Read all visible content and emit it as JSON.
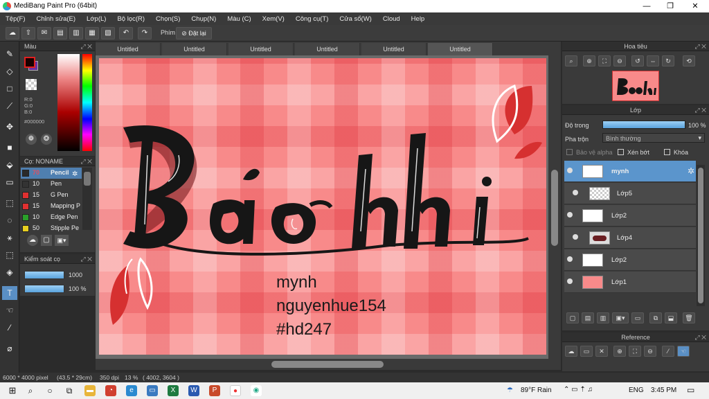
{
  "window": {
    "title": "MediBang Paint Pro (64bit)",
    "min": "—",
    "restore": "❐",
    "close": "✕"
  },
  "menu": [
    "Tệp(F)",
    "Chỉnh sửa(E)",
    "Lớp(L)",
    "Bộ lọc(R)",
    "Chọn(S)",
    "Chụp(N)",
    "Màu (C)",
    "Xem(V)",
    "Công cụ(T)",
    "Cửa sổ(W)",
    "Cloud",
    "Help"
  ],
  "toolbar": {
    "phim_label": "Phím",
    "reset_label": "Đặt lại"
  },
  "color_panel": {
    "title": "Màu",
    "foreground": "#1a0000",
    "background": "#6a2fa0",
    "r": "R:0",
    "g": "G:0",
    "b": "B:0",
    "hex": "#000000"
  },
  "brush_panel": {
    "title": "Cọ: NONAME",
    "brushes": [
      {
        "size": "70",
        "name": "Pencil",
        "color": "#2a2a2a"
      },
      {
        "size": "10",
        "name": "Pen",
        "color": "#333333"
      },
      {
        "size": "15",
        "name": "G Pen",
        "color": "#e03030"
      },
      {
        "size": "15",
        "name": "Mapping P",
        "color": "#e03030"
      },
      {
        "size": "10",
        "name": "Edge Pen",
        "color": "#2aa02a"
      },
      {
        "size": "50",
        "name": "Stipple Pe",
        "color": "#e8d020"
      }
    ]
  },
  "brush_control": {
    "title": "Kiểm soát cọ",
    "size_value": "1000",
    "opacity_value": "100 %"
  },
  "tabs": [
    "Untitled",
    "Untitled",
    "Untitled",
    "Untitled",
    "Untitled",
    "Untitled"
  ],
  "canvas": {
    "lines": [
      "mynh",
      "nguyenhue154",
      "#hd247"
    ]
  },
  "status": {
    "size": "6000 * 4000 pixel",
    "cm": "(43.5 * 29cm)",
    "dpi": "350 dpi",
    "zoom": "13 %",
    "coords": "( 4002, 3604 )"
  },
  "navigator": {
    "title": "Hoa tiêu"
  },
  "layer_panel": {
    "title": "Lớp",
    "opacity_label": "Độ trong",
    "opacity_value": "100 %",
    "opacity_fraction": 1.0,
    "blend_label": "Pha trộn",
    "blend_value": "Bình thường",
    "protect_alpha": "Bảo vệ alpha",
    "clipping": "Xén bớt",
    "lock": "Khóa",
    "layers": [
      {
        "name": "mynh"
      },
      {
        "name": "Lớp5"
      },
      {
        "name": "Lớp2"
      },
      {
        "name": "Lớp4"
      },
      {
        "name": "Lớp2"
      },
      {
        "name": "Lớp1"
      }
    ]
  },
  "reference": {
    "title": "Reference"
  },
  "taskbar": {
    "weather": "89°F  Rain",
    "lang": "ENG",
    "time": "3:45 PM"
  }
}
